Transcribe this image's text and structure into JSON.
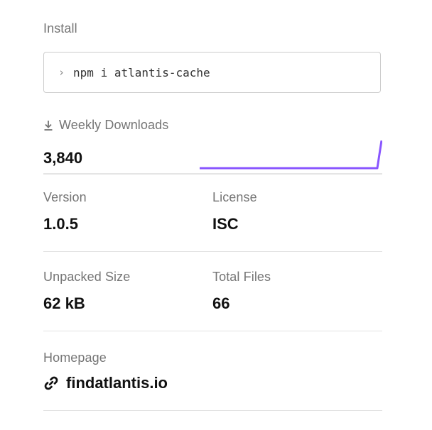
{
  "install": {
    "label": "Install",
    "prompt_icon": "chevron-right-icon",
    "command": "npm i atlantis-cache"
  },
  "downloads": {
    "icon": "download-icon",
    "label": "Weekly Downloads",
    "count": "3,840",
    "sparkline_color": "#8956ff"
  },
  "version": {
    "label": "Version",
    "value": "1.0.5"
  },
  "license": {
    "label": "License",
    "value": "ISC"
  },
  "unpacked_size": {
    "label": "Unpacked Size",
    "value": "62 kB"
  },
  "total_files": {
    "label": "Total Files",
    "value": "66"
  },
  "homepage": {
    "label": "Homepage",
    "icon": "link-icon",
    "url": "findatlantis.io"
  }
}
